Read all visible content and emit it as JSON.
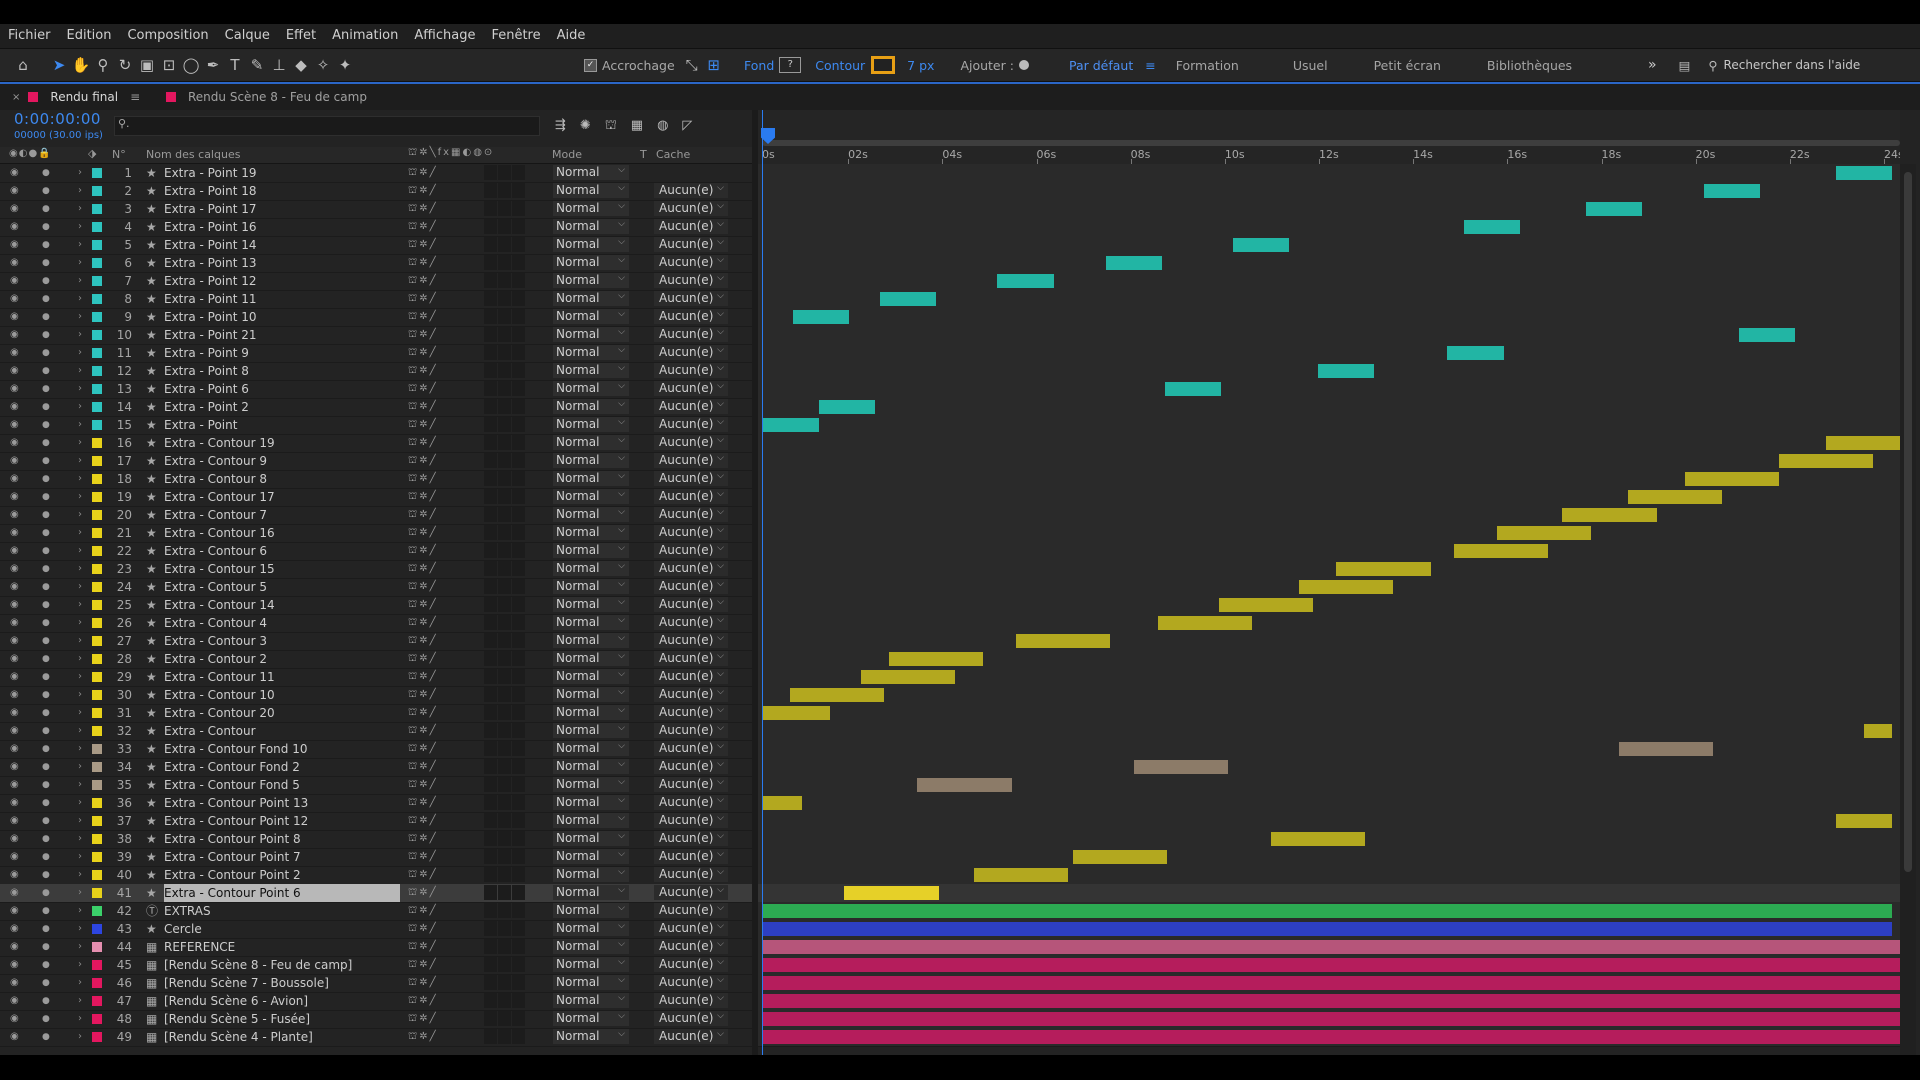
{
  "menu": [
    "Fichier",
    "Edition",
    "Composition",
    "Calque",
    "Effet",
    "Animation",
    "Affichage",
    "Fenêtre",
    "Aide"
  ],
  "toolbar": {
    "snapping_label": "Accrochage",
    "fill_label": "Fond",
    "stroke_label": "Contour",
    "stroke_width": "7 px",
    "add_label": "Ajouter :",
    "workspaces": [
      "Par défaut",
      "Formation",
      "Usuel",
      "Petit écran",
      "Bibliothèques"
    ],
    "search_help_placeholder": "Rechercher dans l'aide"
  },
  "tabs": [
    {
      "label": "Rendu final",
      "color": "#e3175f",
      "active": true
    },
    {
      "label": "Rendu Scène 8 - Feu de camp",
      "color": "#e3175f",
      "active": false
    }
  ],
  "timecode": "0:00:00:00",
  "fps_info": "00000 (30.00 ips)",
  "columns": {
    "number": "N°",
    "layer_name": "Nom des calques",
    "mode": "Mode",
    "t": "T",
    "cache": "Cache"
  },
  "ruler_ticks": [
    "0s",
    "02s",
    "04s",
    "06s",
    "08s",
    "10s",
    "12s",
    "14s",
    "16s",
    "18s",
    "20s",
    "22s",
    "24s"
  ],
  "timeline_duration_seconds": 24,
  "colors": {
    "accent": "#2a7bf0",
    "aqua": "#22b5a4",
    "yellow": "#b3a81f",
    "sandstone": "#8c7b68",
    "green": "#2cab52",
    "blue": "#2d3fc4",
    "pink": "#b6557a",
    "magenta": "#b51d5c"
  },
  "layers": [
    {
      "num": "1",
      "name": "Extra - Point 19",
      "color": "#2ec4bf",
      "icon": "star-icon",
      "mode": "Normal",
      "cache": "",
      "bar": {
        "start": 22.8,
        "end": 24.0,
        "color": "#22b5a4"
      }
    },
    {
      "num": "2",
      "name": "Extra - Point 18",
      "color": "#2ec4bf",
      "icon": "star-icon",
      "mode": "Normal",
      "cache": "Aucun(e)",
      "bar": {
        "start": 20.0,
        "end": 21.2,
        "color": "#22b5a4"
      }
    },
    {
      "num": "3",
      "name": "Extra - Point 17",
      "color": "#2ec4bf",
      "icon": "star-icon",
      "mode": "Normal",
      "cache": "Aucun(e)",
      "bar": {
        "start": 17.5,
        "end": 18.7,
        "color": "#22b5a4"
      }
    },
    {
      "num": "4",
      "name": "Extra - Point 16",
      "color": "#2ec4bf",
      "icon": "star-icon",
      "mode": "Normal",
      "cache": "Aucun(e)",
      "bar": {
        "start": 14.9,
        "end": 16.1,
        "color": "#22b5a4"
      }
    },
    {
      "num": "5",
      "name": "Extra - Point 14",
      "color": "#2ec4bf",
      "icon": "star-icon",
      "mode": "Normal",
      "cache": "Aucun(e)",
      "bar": {
        "start": 10.0,
        "end": 11.2,
        "color": "#22b5a4"
      }
    },
    {
      "num": "6",
      "name": "Extra - Point 13",
      "color": "#2ec4bf",
      "icon": "star-icon",
      "mode": "Normal",
      "cache": "Aucun(e)",
      "bar": {
        "start": 7.3,
        "end": 8.5,
        "color": "#22b5a4"
      }
    },
    {
      "num": "7",
      "name": "Extra - Point 12",
      "color": "#2ec4bf",
      "icon": "star-icon",
      "mode": "Normal",
      "cache": "Aucun(e)",
      "bar": {
        "start": 5.0,
        "end": 6.2,
        "color": "#22b5a4"
      }
    },
    {
      "num": "8",
      "name": "Extra - Point 11",
      "color": "#2ec4bf",
      "icon": "star-icon",
      "mode": "Normal",
      "cache": "Aucun(e)",
      "bar": {
        "start": 2.5,
        "end": 3.7,
        "color": "#22b5a4"
      }
    },
    {
      "num": "9",
      "name": "Extra - Point 10",
      "color": "#2ec4bf",
      "icon": "star-icon",
      "mode": "Normal",
      "cache": "Aucun(e)",
      "bar": {
        "start": 0.65,
        "end": 1.85,
        "color": "#22b5a4"
      }
    },
    {
      "num": "10",
      "name": "Extra - Point 21",
      "color": "#2ec4bf",
      "icon": "star-icon",
      "mode": "Normal",
      "cache": "Aucun(e)",
      "bar": {
        "start": 20.75,
        "end": 21.95,
        "color": "#22b5a4"
      }
    },
    {
      "num": "11",
      "name": "Extra - Point 9",
      "color": "#2ec4bf",
      "icon": "star-icon",
      "mode": "Normal",
      "cache": "Aucun(e)",
      "bar": {
        "start": 14.55,
        "end": 15.75,
        "color": "#22b5a4"
      }
    },
    {
      "num": "12",
      "name": "Extra - Point 8",
      "color": "#2ec4bf",
      "icon": "star-icon",
      "mode": "Normal",
      "cache": "Aucun(e)",
      "bar": {
        "start": 11.8,
        "end": 13.0,
        "color": "#22b5a4"
      }
    },
    {
      "num": "13",
      "name": "Extra - Point 6",
      "color": "#2ec4bf",
      "icon": "star-icon",
      "mode": "Normal",
      "cache": "Aucun(e)",
      "bar": {
        "start": 8.55,
        "end": 9.75,
        "color": "#22b5a4"
      }
    },
    {
      "num": "14",
      "name": "Extra - Point 2",
      "color": "#2ec4bf",
      "icon": "star-icon",
      "mode": "Normal",
      "cache": "Aucun(e)",
      "bar": {
        "start": 1.2,
        "end": 2.4,
        "color": "#22b5a4"
      }
    },
    {
      "num": "15",
      "name": "Extra - Point",
      "color": "#2ec4bf",
      "icon": "star-icon",
      "mode": "Normal",
      "cache": "Aucun(e)",
      "bar": {
        "start": 0.0,
        "end": 1.2,
        "color": "#22b5a4"
      }
    },
    {
      "num": "16",
      "name": "Extra - Contour 19",
      "color": "#e8d21a",
      "icon": "star-icon",
      "mode": "Normal",
      "cache": "Aucun(e)",
      "bar": {
        "start": 22.6,
        "end": 24.2,
        "color": "#b3a81f"
      }
    },
    {
      "num": "17",
      "name": "Extra - Contour 9",
      "color": "#e8d21a",
      "icon": "star-icon",
      "mode": "Normal",
      "cache": "Aucun(e)",
      "bar": {
        "start": 21.6,
        "end": 23.6,
        "color": "#b3a81f"
      }
    },
    {
      "num": "18",
      "name": "Extra - Contour 8",
      "color": "#e8d21a",
      "icon": "star-icon",
      "mode": "Normal",
      "cache": "Aucun(e)",
      "bar": {
        "start": 19.6,
        "end": 21.6,
        "color": "#b3a81f"
      }
    },
    {
      "num": "19",
      "name": "Extra - Contour 17",
      "color": "#e8d21a",
      "icon": "star-icon",
      "mode": "Normal",
      "cache": "Aucun(e)",
      "bar": {
        "start": 18.4,
        "end": 20.4,
        "color": "#b3a81f"
      }
    },
    {
      "num": "20",
      "name": "Extra - Contour 7",
      "color": "#e8d21a",
      "icon": "star-icon",
      "mode": "Normal",
      "cache": "Aucun(e)",
      "bar": {
        "start": 17.0,
        "end": 19.0,
        "color": "#b3a81f"
      }
    },
    {
      "num": "21",
      "name": "Extra - Contour 16",
      "color": "#e8d21a",
      "icon": "star-icon",
      "mode": "Normal",
      "cache": "Aucun(e)",
      "bar": {
        "start": 15.6,
        "end": 17.6,
        "color": "#b3a81f"
      }
    },
    {
      "num": "22",
      "name": "Extra - Contour 6",
      "color": "#e8d21a",
      "icon": "star-icon",
      "mode": "Normal",
      "cache": "Aucun(e)",
      "bar": {
        "start": 14.7,
        "end": 16.7,
        "color": "#b3a81f"
      }
    },
    {
      "num": "23",
      "name": "Extra - Contour 15",
      "color": "#e8d21a",
      "icon": "star-icon",
      "mode": "Normal",
      "cache": "Aucun(e)",
      "bar": {
        "start": 12.2,
        "end": 14.2,
        "color": "#b3a81f"
      }
    },
    {
      "num": "24",
      "name": "Extra - Contour 5",
      "color": "#e8d21a",
      "icon": "star-icon",
      "mode": "Normal",
      "cache": "Aucun(e)",
      "bar": {
        "start": 11.4,
        "end": 13.4,
        "color": "#b3a81f"
      }
    },
    {
      "num": "25",
      "name": "Extra - Contour 14",
      "color": "#e8d21a",
      "icon": "star-icon",
      "mode": "Normal",
      "cache": "Aucun(e)",
      "bar": {
        "start": 9.7,
        "end": 11.7,
        "color": "#b3a81f"
      }
    },
    {
      "num": "26",
      "name": "Extra - Contour 4",
      "color": "#e8d21a",
      "icon": "star-icon",
      "mode": "Normal",
      "cache": "Aucun(e)",
      "bar": {
        "start": 8.4,
        "end": 10.4,
        "color": "#b3a81f"
      }
    },
    {
      "num": "27",
      "name": "Extra - Contour 3",
      "color": "#e8d21a",
      "icon": "star-icon",
      "mode": "Normal",
      "cache": "Aucun(e)",
      "bar": {
        "start": 5.4,
        "end": 7.4,
        "color": "#b3a81f"
      }
    },
    {
      "num": "28",
      "name": "Extra - Contour 2",
      "color": "#e8d21a",
      "icon": "star-icon",
      "mode": "Normal",
      "cache": "Aucun(e)",
      "bar": {
        "start": 2.7,
        "end": 4.7,
        "color": "#b3a81f"
      }
    },
    {
      "num": "29",
      "name": "Extra - Contour 11",
      "color": "#e8d21a",
      "icon": "star-icon",
      "mode": "Normal",
      "cache": "Aucun(e)",
      "bar": {
        "start": 2.1,
        "end": 4.1,
        "color": "#b3a81f"
      }
    },
    {
      "num": "30",
      "name": "Extra - Contour 10",
      "color": "#e8d21a",
      "icon": "star-icon",
      "mode": "Normal",
      "cache": "Aucun(e)",
      "bar": {
        "start": 0.6,
        "end": 2.6,
        "color": "#b3a81f"
      }
    },
    {
      "num": "31",
      "name": "Extra - Contour 20",
      "color": "#e8d21a",
      "icon": "star-icon",
      "mode": "Normal",
      "cache": "Aucun(e)",
      "bar": {
        "start": 0.0,
        "end": 1.45,
        "color": "#b3a81f"
      }
    },
    {
      "num": "32",
      "name": "Extra - Contour",
      "color": "#e8d21a",
      "icon": "star-icon",
      "mode": "Normal",
      "cache": "Aucun(e)",
      "bar": {
        "start": 23.4,
        "end": 24.0,
        "color": "#b3a81f"
      }
    },
    {
      "num": "33",
      "name": "Extra - Contour Fond 10",
      "color": "#a99a86",
      "icon": "star-icon",
      "mode": "Normal",
      "cache": "Aucun(e)",
      "bar": {
        "start": 18.2,
        "end": 20.2,
        "color": "#8c7b68"
      }
    },
    {
      "num": "34",
      "name": "Extra - Contour Fond 2",
      "color": "#a99a86",
      "icon": "star-icon",
      "mode": "Normal",
      "cache": "Aucun(e)",
      "bar": {
        "start": 7.9,
        "end": 9.9,
        "color": "#8c7b68"
      }
    },
    {
      "num": "35",
      "name": "Extra - Contour Fond 5",
      "color": "#a99a86",
      "icon": "star-icon",
      "mode": "Normal",
      "cache": "Aucun(e)",
      "bar": {
        "start": 3.3,
        "end": 5.3,
        "color": "#8c7b68"
      }
    },
    {
      "num": "36",
      "name": "Extra - Contour Point 13",
      "color": "#e8d21a",
      "icon": "star-icon",
      "mode": "Normal",
      "cache": "Aucun(e)",
      "bar": {
        "start": 0.0,
        "end": 0.85,
        "color": "#b3a81f"
      }
    },
    {
      "num": "37",
      "name": "Extra - Contour Point 12",
      "color": "#e8d21a",
      "icon": "star-icon",
      "mode": "Normal",
      "cache": "Aucun(e)",
      "bar": {
        "start": 22.8,
        "end": 24.0,
        "color": "#b3a81f"
      }
    },
    {
      "num": "38",
      "name": "Extra - Contour Point 8",
      "color": "#e8d21a",
      "icon": "star-icon",
      "mode": "Normal",
      "cache": "Aucun(e)",
      "bar": {
        "start": 10.8,
        "end": 12.8,
        "color": "#b3a81f"
      }
    },
    {
      "num": "39",
      "name": "Extra - Contour Point 7",
      "color": "#e8d21a",
      "icon": "star-icon",
      "mode": "Normal",
      "cache": "Aucun(e)",
      "bar": {
        "start": 6.6,
        "end": 8.6,
        "color": "#b3a81f"
      }
    },
    {
      "num": "40",
      "name": "Extra - Contour Point 2",
      "color": "#e8d21a",
      "icon": "star-icon",
      "mode": "Normal",
      "cache": "Aucun(e)",
      "bar": {
        "start": 4.5,
        "end": 6.5,
        "color": "#b3a81f"
      }
    },
    {
      "num": "41",
      "name": "Extra - Contour Point 6",
      "color": "#e8d21a",
      "icon": "star-icon",
      "mode": "Normal",
      "cache": "Aucun(e)",
      "selected": true,
      "bar": {
        "start": 1.75,
        "end": 3.75,
        "color": "#e6d028"
      }
    },
    {
      "num": "42",
      "name": "EXTRAS",
      "color": "#3bd16a",
      "icon": "text-layer-icon",
      "mode": "Normal",
      "cache": "Aucun(e)",
      "bar": {
        "start": 0.0,
        "end": 24.0,
        "color": "#2cab52"
      }
    },
    {
      "num": "43",
      "name": "Cercle",
      "color": "#2d45e0",
      "icon": "star-icon",
      "mode": "Normal",
      "cache": "Aucun(e)",
      "bar": {
        "start": 0.0,
        "end": 24.0,
        "color": "#2d3fc4"
      }
    },
    {
      "num": "44",
      "name": "REFERENCE",
      "color": "#e58fb0",
      "icon": "composition-icon",
      "mode": "Normal",
      "cache": "Aucun(e)",
      "bar": {
        "start": 0.0,
        "end": 24.2,
        "color": "#b6557a"
      }
    },
    {
      "num": "45",
      "name": "[Rendu Scène 8 - Feu de camp]",
      "color": "#e3175f",
      "icon": "composition-icon",
      "mode": "Normal",
      "cache": "Aucun(e)",
      "bar": {
        "start": 0.0,
        "end": 24.2,
        "color": "#b51d5c"
      }
    },
    {
      "num": "46",
      "name": "[Rendu Scène 7 - Boussole]",
      "color": "#e3175f",
      "icon": "composition-icon",
      "mode": "Normal",
      "cache": "Aucun(e)",
      "bar": {
        "start": 0.0,
        "end": 24.2,
        "color": "#b51d5c"
      }
    },
    {
      "num": "47",
      "name": "[Rendu Scène 6 - Avion]",
      "color": "#e3175f",
      "icon": "composition-icon",
      "mode": "Normal",
      "cache": "Aucun(e)",
      "bar": {
        "start": 0.0,
        "end": 24.2,
        "color": "#b51d5c"
      }
    },
    {
      "num": "48",
      "name": "[Rendu Scène 5 - Fusée]",
      "color": "#e3175f",
      "icon": "composition-icon",
      "mode": "Normal",
      "cache": "Aucun(e)",
      "bar": {
        "start": 0.0,
        "end": 24.2,
        "color": "#b51d5c"
      }
    },
    {
      "num": "49",
      "name": "[Rendu Scène 4 - Plante]",
      "color": "#e3175f",
      "icon": "composition-icon",
      "mode": "Normal",
      "cache": "Aucun(e)",
      "bar": {
        "start": 0.0,
        "end": 24.2,
        "color": "#b51d5c"
      }
    }
  ]
}
